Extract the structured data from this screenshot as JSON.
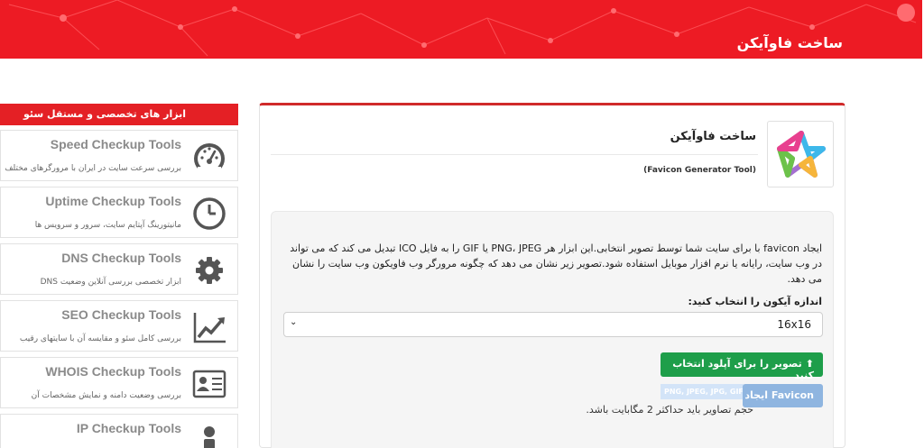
{
  "header": {
    "title": "ساخت فاوآیکن"
  },
  "sidebar": {
    "heading": "ابزار های تخصصی و مستقل سئو",
    "tools": [
      {
        "title": "Speed Checkup Tools",
        "desc": "بررسی سرعت سایت در ایران با مرورگرهای مختلف",
        "icon": "speedometer-icon"
      },
      {
        "title": "Uptime Checkup Tools",
        "desc": "مانیتورینگ آپتایم سایت، سرور و سرویس ها",
        "icon": "clock-icon"
      },
      {
        "title": "DNS Checkup Tools",
        "desc": "ابزار تخصصی بررسی آنلاین وضعیت DNS",
        "icon": "gear-icon"
      },
      {
        "title": "SEO Checkup Tools",
        "desc": "بررسی کامل سئو و مقایسه آن با سایتهای رقیب",
        "icon": "trend-chart-icon"
      },
      {
        "title": "WHOIS Checkup Tools",
        "desc": "بررسی وضعیت دامنه و نمایش مشخصات آن",
        "icon": "id-card-icon"
      },
      {
        "title": "IP Checkup Tools",
        "desc": "",
        "icon": "person-icon"
      }
    ]
  },
  "main": {
    "title": "ساخت فاوآیکن",
    "subtitle": "(Favicon Generator Tool)",
    "description": "ایجاد favicon با برای سایت شما توسط تصویر انتخابی.این ابزار هر PNG، JPEG یا GIF را به فایل ICO تبدیل می کند که می تواند در وب سایت، رایانه یا نرم افزار موبایل استفاده شود.تصویر زیر نشان می دهد که چگونه مرورگر وب فاویکون وب سایت را نشان می دهد.",
    "size_label": "اندازه آیکون را انتخاب کنید:",
    "size_value": "16x16",
    "upload_label": "تصویر را برای آپلود انتخاب کنید",
    "create_label": "ایجاد Favicon",
    "formats": "PNG, JPEG, JPG, GIF",
    "size_note": "حجم تصاویر باید حداکثر 2 مگابایت باشد."
  },
  "colors": {
    "header": "#ed1b24",
    "sidebar_head": "#e42025",
    "upload_button": "#1e9e4a",
    "create_button": "#8fb5e0"
  }
}
